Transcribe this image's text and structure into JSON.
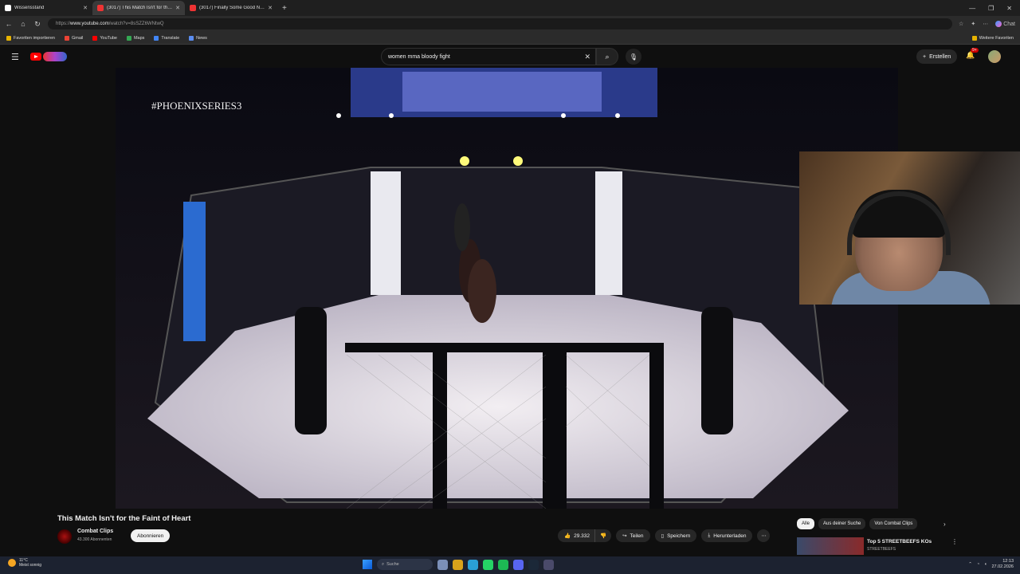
{
  "browser": {
    "tabs": [
      {
        "label": "Wissensstand"
      },
      {
        "label": "(3017) This Match Isn't for the Fa..."
      },
      {
        "label": "(3017) Finally Some Good News A..."
      }
    ],
    "url_prefix": "https://",
    "url_host": "www.youtube.com",
    "url_path": "/watch?v=8sSZZ6WNtwQ",
    "bookmarks": [
      "Favoriten importieren",
      "Gmail",
      "YouTube",
      "Maps",
      "Translate",
      "News"
    ],
    "bookmarks_right": "Weitere Favoriten",
    "chat_label": "Chat"
  },
  "youtube": {
    "search_query": "women mma bloody fight",
    "create_label": "Erstellen",
    "notif_count": "9+"
  },
  "video": {
    "overlay_text": "#PHOENIXSERIES3",
    "title": "This Match Isn't for the Faint of Heart",
    "channel": "Combat Clips",
    "subscribers": "43.300 Abonnenten",
    "subscribe_label": "Abonnieren",
    "likes": "29.332",
    "share_label": "Teilen",
    "save_label": "Speichern",
    "download_label": "Herunterladen"
  },
  "sidebar": {
    "chips": [
      "Alle",
      "Aus deiner Suche",
      "Von Combat Clips"
    ],
    "rec_title": "Top 5 STREETBEEFS KOs",
    "rec_channel": "STREETBEEFS"
  },
  "taskbar": {
    "temp": "11°C",
    "weather": "Meist sonnig",
    "search": "Suche",
    "time": "12:13",
    "date": "27.02.2026"
  },
  "colors": {
    "accent_red": "#ff0000",
    "bg": "#0f0f0f"
  }
}
